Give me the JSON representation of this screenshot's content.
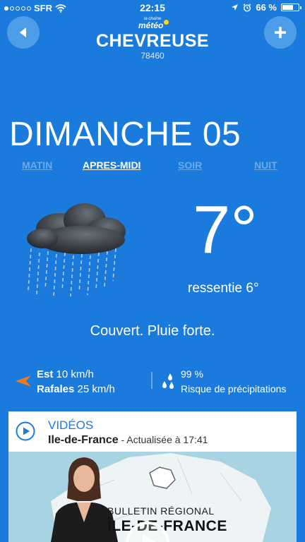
{
  "status_bar": {
    "carrier": "SFR",
    "time": "22:15",
    "battery": "66 %",
    "battery_level": 0.66,
    "signal_bars": 1
  },
  "header": {
    "logo_top": "la chaîne",
    "logo_main": "météo",
    "city": "CHEVREUSE",
    "zip": "78460",
    "back_icon": "back-arrow-icon",
    "add_icon": "plus-icon"
  },
  "day": {
    "title": "DIMANCHE 05",
    "tabs": [
      {
        "label": "MATIN",
        "active": false
      },
      {
        "label": "APRES-MIDI",
        "active": true
      },
      {
        "label": "SOIR",
        "active": false
      },
      {
        "label": "NUIT",
        "active": false
      }
    ]
  },
  "weather": {
    "icon": "rain-cloud-icon",
    "temperature": "7°",
    "feels_like": "ressentie 6°",
    "description": "Couvert. Pluie forte."
  },
  "wind": {
    "icon": "wind-direction-arrow-icon",
    "direction": "Est",
    "speed": "10 km/h",
    "gust_label": "Rafales",
    "gust_speed": "25 km/h"
  },
  "precipitation": {
    "icon": "raindrops-icon",
    "percent": "99 %",
    "label": "Risque de précipitations"
  },
  "video_card": {
    "icon": "play-circle-icon",
    "title": "VIDÉOS",
    "region": "Ile-de-France",
    "updated": " - Actualisée à 17:41",
    "thumbnail_line1": "BULLETIN RÉGIONAL",
    "thumbnail_line2": "ÎLE-DE-FRANCE"
  },
  "colors": {
    "background": "#1a7bdc",
    "inactive_tab": "#6aa9ec",
    "wind_arrow": "#f07a1e",
    "card_title": "#1a7bdc"
  }
}
